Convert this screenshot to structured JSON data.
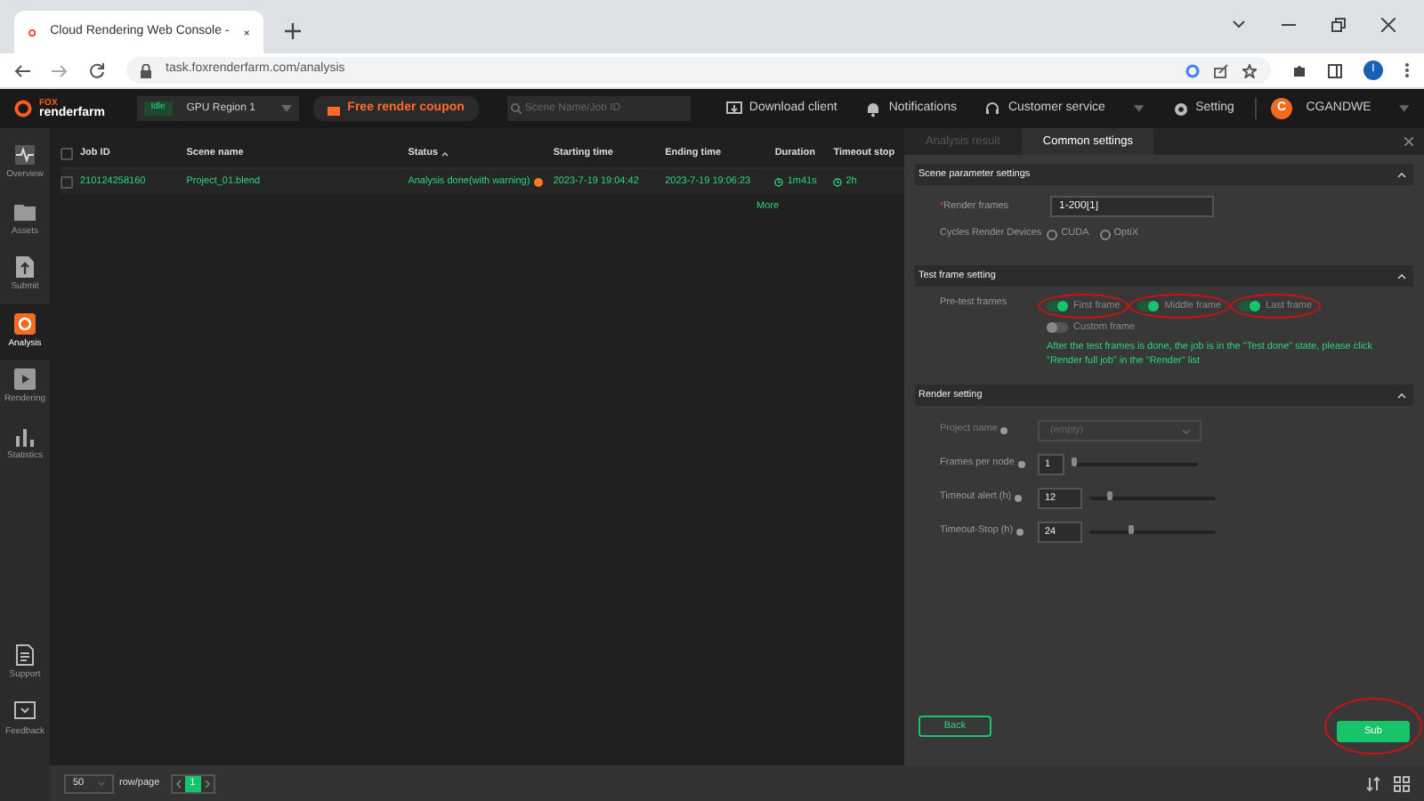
{
  "browser": {
    "tab_title": "Cloud Rendering Web Console -",
    "url": "task.foxrenderfarm.com/analysis",
    "profile": "I"
  },
  "header": {
    "logo_top": "FOX",
    "logo_bottom": "renderfarm",
    "region_status": "Idle",
    "region": "GPU Region 1",
    "coupon": "Free render coupon",
    "search_placeholder": "Scene Name/Job ID",
    "links": [
      "Download client",
      "Notifications",
      "Customer service",
      "Setting"
    ],
    "avatar": "C",
    "user": "CGANDWE"
  },
  "sidebar": {
    "items": [
      {
        "label": "Overview",
        "kind": "pulse",
        "selected": false
      },
      {
        "label": "Assets",
        "kind": "folder",
        "selected": false
      },
      {
        "label": "Submit",
        "kind": "upload",
        "selected": false
      },
      {
        "label": "Analysis",
        "kind": "analysis",
        "selected": true
      },
      {
        "label": "Rendering",
        "kind": "play",
        "selected": false
      },
      {
        "label": "Statistics",
        "kind": "bars",
        "selected": false
      }
    ],
    "bottom_items": [
      {
        "label": "Support",
        "kind": "doc"
      },
      {
        "label": "Feedback",
        "kind": "chat"
      }
    ]
  },
  "table": {
    "all_checked": false,
    "columns": [
      {
        "label": "Job ID",
        "sorted": false
      },
      {
        "label": "Scene name",
        "sorted": false
      },
      {
        "label": "Status",
        "sorted": true
      },
      {
        "label": "Starting time",
        "sorted": false
      },
      {
        "label": "Ending time",
        "sorted": false
      },
      {
        "label": "Duration",
        "sorted": false
      },
      {
        "label": "Timeout stop",
        "sorted": false
      }
    ],
    "rows": [
      {
        "checked": false,
        "cells": [
          "210124258160",
          "Project_01.blend",
          "Analysis done(with warning)",
          "2023-7-19 19:04:42",
          "2023-7-19 19:06:23",
          "1m41s",
          "2h"
        ],
        "warning": true
      }
    ],
    "more": "More"
  },
  "pagination": {
    "page_size": "50",
    "page_size_label": "row/page",
    "pages": [
      {
        "label": "1",
        "selected": true
      }
    ]
  },
  "panel": {
    "tabs": [
      {
        "label": "Analysis result",
        "selected": false
      },
      {
        "label": "Common settings",
        "selected": true
      }
    ],
    "sections": [
      {
        "title": "Scene parameter settings",
        "expanded": true
      },
      {
        "title": "Test frame setting",
        "expanded": true
      },
      {
        "title": "Render setting",
        "expanded": true
      }
    ],
    "render_frames": {
      "required_mark": "*",
      "label": "Render frames",
      "value": "1-200[1]"
    },
    "devices": {
      "label": "Cycles Render Devices",
      "options": [
        {
          "label": "CUDA",
          "selected": false
        },
        {
          "label": "OptiX",
          "selected": false
        }
      ]
    },
    "pretest": {
      "label": "Pre-test frames",
      "toggles": [
        {
          "label": "First frame",
          "on": true,
          "highlighted": true
        },
        {
          "label": "Middle frame",
          "on": true,
          "highlighted": true
        },
        {
          "label": "Last frame",
          "on": true,
          "highlighted": true
        },
        {
          "label": "Custom frame",
          "on": false,
          "highlighted": false
        }
      ],
      "note": "After the test frames is done, the job is in the \"Test done\" state, please click \"Render full job\" in the \"Render\" list"
    },
    "project_name": {
      "label": "Project name",
      "placeholder": "(empty)"
    },
    "sliders": [
      {
        "label": "Frames per node",
        "value": "1",
        "level": 0.0
      },
      {
        "label": "Timeout alert (h)",
        "value": "12",
        "level": 0.15
      },
      {
        "label": "Timeout-Stop (h)",
        "value": "24",
        "level": 0.33
      }
    ],
    "back": "Back",
    "submit": {
      "label": "Sub",
      "highlighted": true
    }
  }
}
